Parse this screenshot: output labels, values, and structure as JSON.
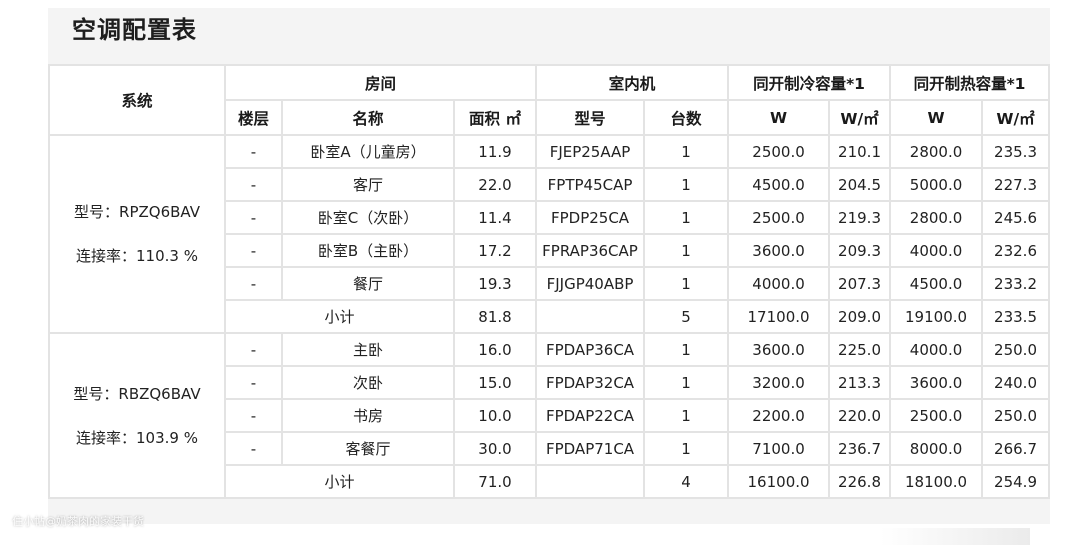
{
  "title": "空调配置表",
  "headers": {
    "system": "系统",
    "room": "房间",
    "indoor_unit": "室内机",
    "cooling": "同开制冷容量*1",
    "heating": "同开制热容量*1",
    "floor": "楼层",
    "name": "名称",
    "area": "面积 ㎡",
    "model": "型号",
    "count": "台数",
    "w": "W",
    "w_per_m2": "W/㎡"
  },
  "systems": [
    {
      "model_label": "型号：RPZQ6BAV",
      "rate_label": "连接率：110.3 %",
      "rows": [
        {
          "floor": "-",
          "name": "卧室A（儿童房）",
          "area": "11.9",
          "model": "FJEP25AAP",
          "count": "1",
          "cool_w": "2500.0",
          "cool_wm2": "210.1",
          "heat_w": "2800.0",
          "heat_wm2": "235.3"
        },
        {
          "floor": "-",
          "name": "客厅",
          "area": "22.0",
          "model": "FPTP45CAP",
          "count": "1",
          "cool_w": "4500.0",
          "cool_wm2": "204.5",
          "heat_w": "5000.0",
          "heat_wm2": "227.3"
        },
        {
          "floor": "-",
          "name": "卧室C（次卧）",
          "area": "11.4",
          "model": "FPDP25CA",
          "count": "1",
          "cool_w": "2500.0",
          "cool_wm2": "219.3",
          "heat_w": "2800.0",
          "heat_wm2": "245.6"
        },
        {
          "floor": "-",
          "name": "卧室B（主卧）",
          "area": "17.2",
          "model": "FPRAP36CAP",
          "count": "1",
          "cool_w": "3600.0",
          "cool_wm2": "209.3",
          "heat_w": "4000.0",
          "heat_wm2": "232.6"
        },
        {
          "floor": "-",
          "name": "餐厅",
          "area": "19.3",
          "model": "FJJGP40ABP",
          "count": "1",
          "cool_w": "4000.0",
          "cool_wm2": "207.3",
          "heat_w": "4500.0",
          "heat_wm2": "233.2"
        }
      ],
      "subtotal": {
        "label": "小计",
        "area": "81.8",
        "count": "5",
        "cool_w": "17100.0",
        "cool_wm2": "209.0",
        "heat_w": "19100.0",
        "heat_wm2": "233.5"
      }
    },
    {
      "model_label": "型号：RBZQ6BAV",
      "rate_label": "连接率：103.9 %",
      "rows": [
        {
          "floor": "-",
          "name": "主卧",
          "area": "16.0",
          "model": "FPDAP36CA",
          "count": "1",
          "cool_w": "3600.0",
          "cool_wm2": "225.0",
          "heat_w": "4000.0",
          "heat_wm2": "250.0"
        },
        {
          "floor": "-",
          "name": "次卧",
          "area": "15.0",
          "model": "FPDAP32CA",
          "count": "1",
          "cool_w": "3200.0",
          "cool_wm2": "213.3",
          "heat_w": "3600.0",
          "heat_wm2": "240.0"
        },
        {
          "floor": "-",
          "name": "书房",
          "area": "10.0",
          "model": "FPDAP22CA",
          "count": "1",
          "cool_w": "2200.0",
          "cool_wm2": "220.0",
          "heat_w": "2500.0",
          "heat_wm2": "250.0"
        },
        {
          "floor": "-",
          "name": "客餐厅",
          "area": "30.0",
          "model": "FPDAP71CA",
          "count": "1",
          "cool_w": "7100.0",
          "cool_wm2": "236.7",
          "heat_w": "8000.0",
          "heat_wm2": "266.7"
        }
      ],
      "subtotal": {
        "label": "小计",
        "area": "71.0",
        "count": "4",
        "cool_w": "16100.0",
        "cool_wm2": "226.8",
        "heat_w": "18100.0",
        "heat_wm2": "254.9"
      }
    }
  ],
  "watermark": "住小帖@奶茶肉的家装干货"
}
